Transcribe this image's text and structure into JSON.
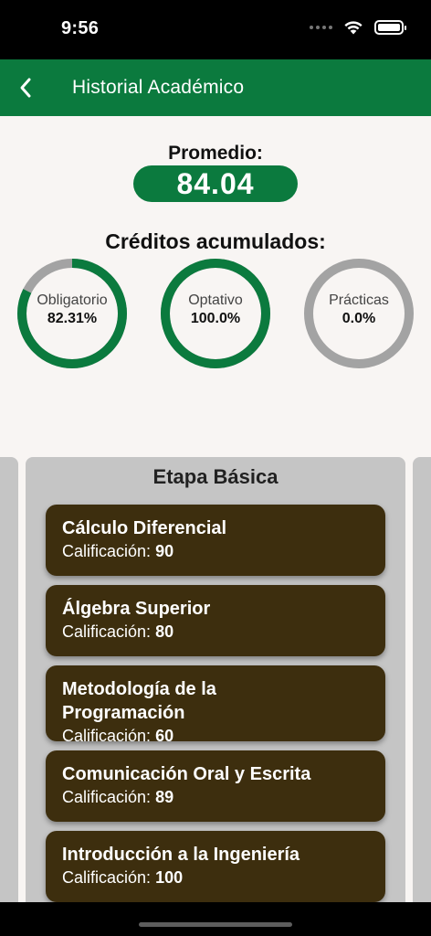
{
  "status_bar": {
    "time": "9:56",
    "icons": [
      "signal-dots-icon",
      "wifi-icon",
      "battery-icon"
    ]
  },
  "nav": {
    "back_icon": "chevron-left-icon",
    "title": "Historial Académico"
  },
  "summary": {
    "average_label": "Promedio:",
    "average_value": "84.04",
    "credits_label": "Créditos acumulados:"
  },
  "credits": [
    {
      "name": "Obligatorio",
      "value": "82.31%",
      "fraction": 0.8231
    },
    {
      "name": "Optativo",
      "value": "100.0%",
      "fraction": 1.0
    },
    {
      "name": "Prácticas",
      "value": "0.0%",
      "fraction": 0.0
    }
  ],
  "stage": {
    "title": "Etapa Básica",
    "grade_label": "Calificación:",
    "courses": [
      {
        "name": "Cálculo Diferencial",
        "grade": "90"
      },
      {
        "name": "Álgebra Superior",
        "grade": "80"
      },
      {
        "name": "Metodología de la Programación",
        "grade": "60"
      },
      {
        "name": "Comunicación Oral y Escrita",
        "grade": "89"
      },
      {
        "name": "Introducción a la Ingeniería",
        "grade": "100"
      }
    ]
  },
  "colors": {
    "primary_green": "#0b7a3e",
    "ring_track": "#a3a3a3",
    "course_card": "#3d2e0e",
    "panel": "#c5c5c5",
    "background": "#f8f5f3"
  }
}
